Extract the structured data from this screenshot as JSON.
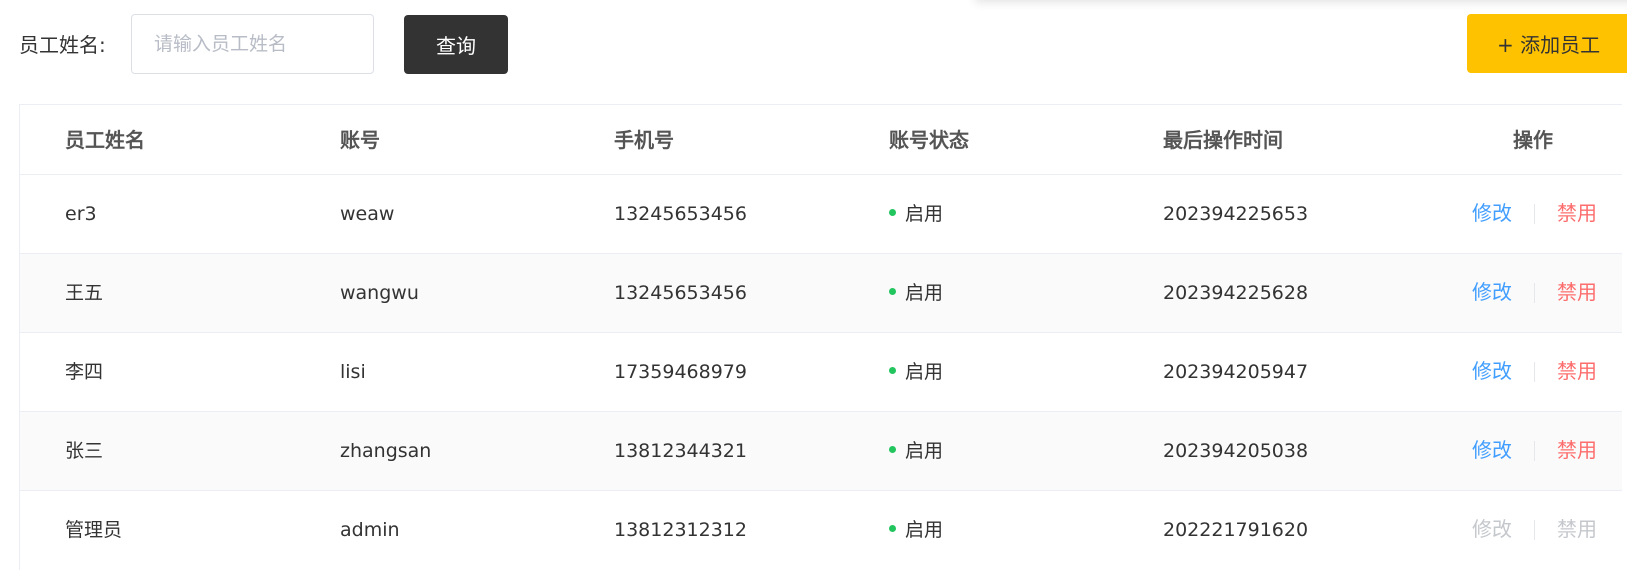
{
  "toolbar": {
    "search_label": "员工姓名:",
    "search_placeholder": "请输入员工姓名",
    "search_value": "",
    "query_label": "查询",
    "add_label": "+ 添加员工"
  },
  "table": {
    "columns": [
      "员工姓名",
      "账号",
      "手机号",
      "账号状态",
      "最后操作时间",
      "操作"
    ],
    "rows": [
      {
        "name": "er3",
        "account": "weaw",
        "phone": "13245653456",
        "status": "启用",
        "last_op": "202394225653",
        "edit": "修改",
        "disable": "禁用",
        "actions_enabled": true
      },
      {
        "name": "王五",
        "account": "wangwu",
        "phone": "13245653456",
        "status": "启用",
        "last_op": "202394225628",
        "edit": "修改",
        "disable": "禁用",
        "actions_enabled": true
      },
      {
        "name": "李四",
        "account": "lisi",
        "phone": "17359468979",
        "status": "启用",
        "last_op": "202394205947",
        "edit": "修改",
        "disable": "禁用",
        "actions_enabled": true
      },
      {
        "name": "张三",
        "account": "zhangsan",
        "phone": "13812344321",
        "status": "启用",
        "last_op": "202394205038",
        "edit": "修改",
        "disable": "禁用",
        "actions_enabled": true
      },
      {
        "name": "管理员",
        "account": "admin",
        "phone": "13812312312",
        "status": "启用",
        "last_op": "202221791620",
        "edit": "修改",
        "disable": "禁用",
        "actions_enabled": false
      }
    ]
  },
  "colors": {
    "primary_dark": "#333333",
    "accent_yellow": "#ffc200",
    "link_blue": "#419eff",
    "danger_red": "#fd6d6d",
    "status_green": "#22c55e",
    "disabled_gray": "#c4c7cc"
  }
}
